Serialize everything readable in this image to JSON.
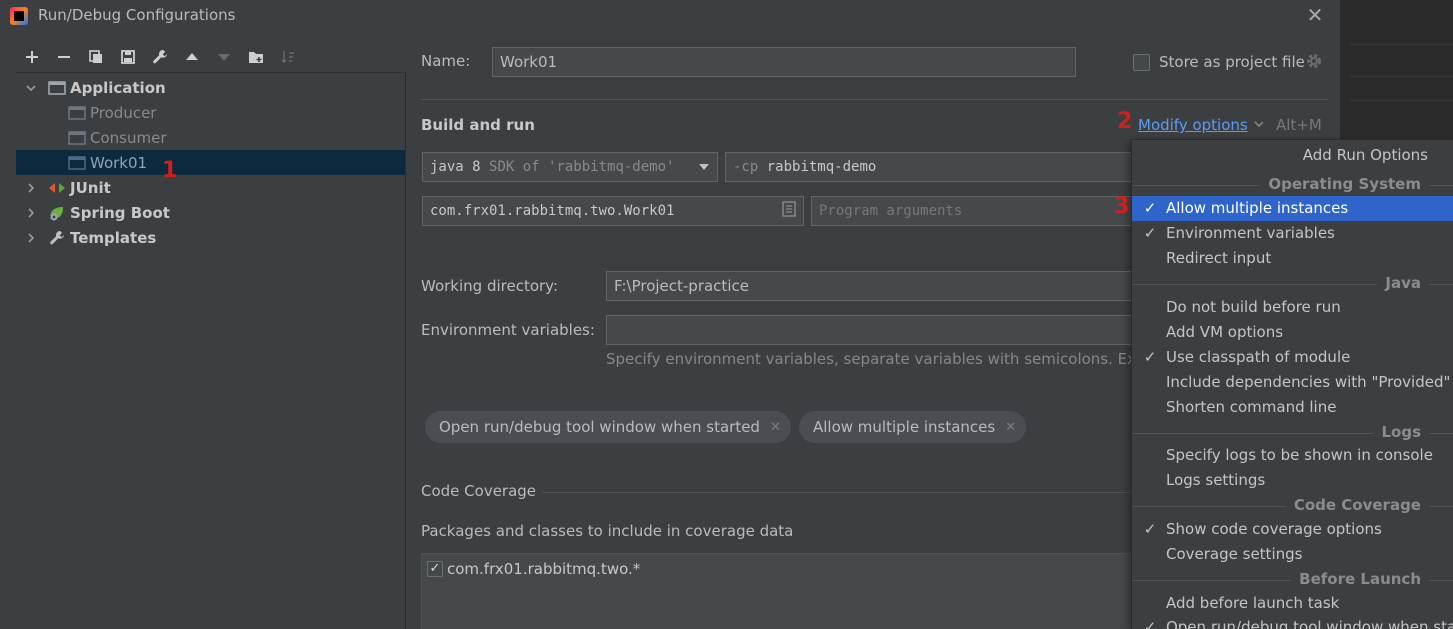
{
  "window": {
    "title": "Run/Debug Configurations"
  },
  "tree": {
    "application": {
      "label": "Application",
      "children": [
        "Producer",
        "Consumer",
        "Work01"
      ]
    },
    "junit": "JUnit",
    "spring_boot": "Spring Boot",
    "templates": "Templates"
  },
  "annotations": {
    "one": "1",
    "two": "2",
    "three": "3"
  },
  "form": {
    "name_label": "Name:",
    "name_value": "Work01",
    "store_label": "Store as project file",
    "section_build": "Build and run",
    "modify_options": "Modify options",
    "modify_shortcut": "Alt+M",
    "sdk_bold": "java 8",
    "sdk_rest": "SDK of 'rabbitmq-demo'",
    "cp_prefix": "-cp",
    "cp_value": "rabbitmq-demo",
    "main_class": "com.frx01.rabbitmq.two.Work01",
    "program_args_placeholder": "Program arguments",
    "workdir_label": "Working directory:",
    "workdir_value": "F:\\Project-practice",
    "env_label": "Environment variables:",
    "env_hint": "Specify environment variables, separate variables with semicolons. Examp",
    "chips": [
      "Open run/debug tool window when started",
      "Allow multiple instances"
    ],
    "code_coverage": "Code Coverage",
    "coverage_packages": "Packages and classes to include in coverage data",
    "coverage_entry": "com.frx01.rabbitmq.two.*"
  },
  "popup": {
    "title": "Add Run Options",
    "sections": {
      "os": "Operating System",
      "java": "Java",
      "logs": "Logs",
      "coverage": "Code Coverage",
      "before": "Before Launch"
    },
    "items": {
      "allow_multiple": "Allow multiple instances",
      "env_vars": "Environment variables",
      "redirect": "Redirect input",
      "no_build": "Do not build before run",
      "add_vm": "Add VM options",
      "classpath": "Use classpath of module",
      "include_deps": "Include dependencies with \"Provided\" s",
      "shorten": "Shorten command line",
      "specify_logs": "Specify logs to be shown in console",
      "logs_settings": "Logs settings",
      "show_coverage": "Show code coverage options",
      "coverage_settings": "Coverage settings",
      "add_before": "Add before launch task",
      "open_tool": "Open run/debug tool window when star"
    },
    "check_glyph": "✓"
  },
  "colors": {
    "accent": "#589df6",
    "selection": "#2f65ca",
    "annotation": "#d11f1f"
  }
}
